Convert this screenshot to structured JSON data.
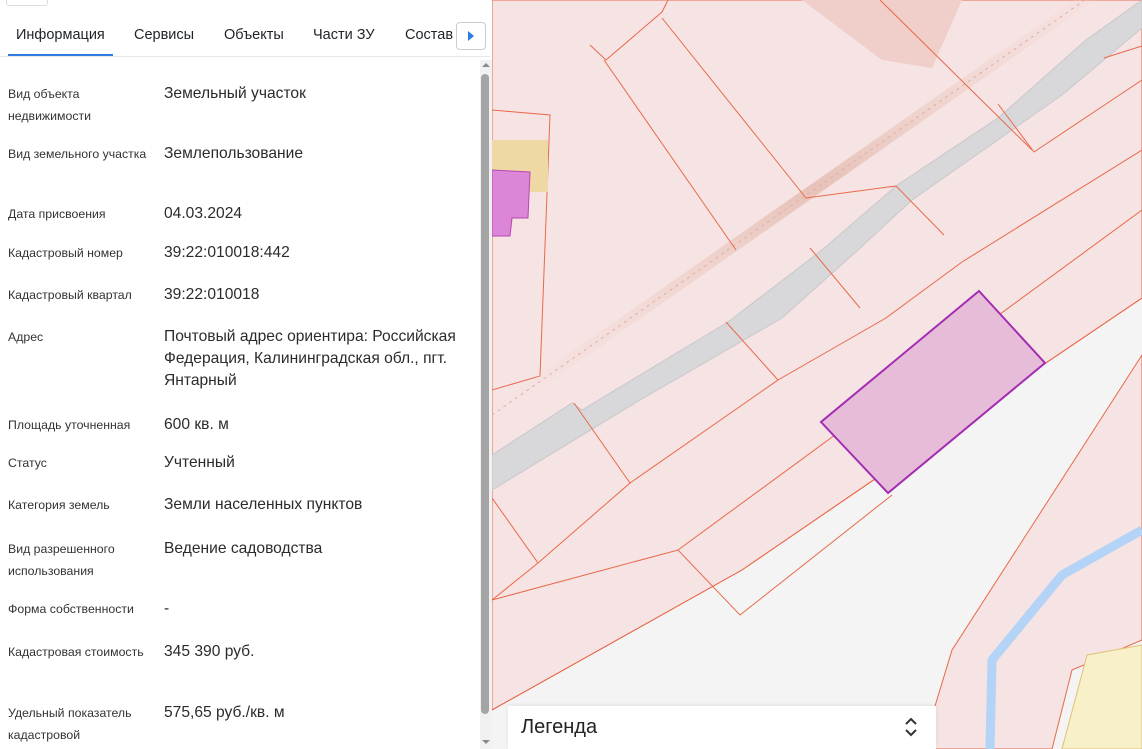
{
  "tabs": [
    {
      "label": "Информация",
      "active": true
    },
    {
      "label": "Сервисы",
      "active": false
    },
    {
      "label": "Объекты",
      "active": false
    },
    {
      "label": "Части ЗУ",
      "active": false
    },
    {
      "label": "Состав",
      "active": false
    }
  ],
  "tab_scroll_icon": "triangle-right-icon",
  "fields": [
    {
      "label": "Вид объекта недвижимости",
      "value": "Земельный участок"
    },
    {
      "label": "Вид земельного участка",
      "value": "Землепользование"
    },
    {
      "label": "Дата присвоения",
      "value": "04.03.2024"
    },
    {
      "label": "Кадастровый номер",
      "value": "39:22:010018:442"
    },
    {
      "label": "Кадастровый квартал",
      "value": "39:22:010018"
    },
    {
      "label": "Адрес",
      "value": "Почтовый адрес ориентира: Российская Федерация, Калининградская обл., пгт. Янтарный"
    },
    {
      "label": "Площадь уточненная",
      "value": "600 кв. м"
    },
    {
      "label": "Статус",
      "value": "Учтенный"
    },
    {
      "label": "Категория земель",
      "value": "Земли населенных пунктов"
    },
    {
      "label": "Вид разрешенного использования",
      "value": "Ведение садоводства"
    },
    {
      "label": "Форма собственности",
      "value": "-"
    },
    {
      "label": "Кадастровая стоимость",
      "value": "345 390 руб."
    },
    {
      "label": "Удельный показатель кадастровой",
      "value": "575,65 руб./кв. м"
    }
  ],
  "legend": {
    "title": "Легенда",
    "toggle_icon": "chevron-up-down-icon"
  },
  "colors": {
    "accent": "#2f7de1",
    "parcel_fill": "#f5e1e1",
    "parcel_border": "#e8694a",
    "selected_parcel_fill": "#e7bcd8",
    "selected_parcel_border": "#a32cb3",
    "road": "#d8d8da",
    "river": "#b3d3f7"
  }
}
